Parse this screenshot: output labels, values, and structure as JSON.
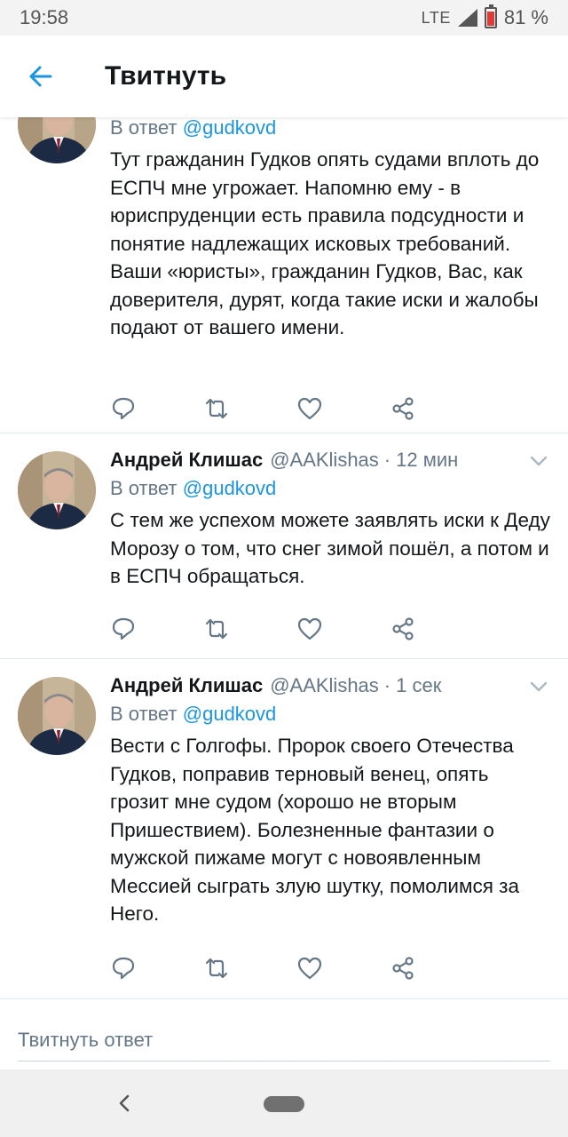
{
  "status_bar": {
    "time": "19:58",
    "network": "LTE",
    "battery_text": "81 %",
    "battery_level": 0.81
  },
  "app_bar": {
    "back_icon": "arrow-left-icon",
    "title": "Твитнуть"
  },
  "tweets": [
    {
      "name": "",
      "handle": "",
      "time": "",
      "reply_prefix": "В ответ",
      "reply_to": "@gudkovd",
      "text": "Тут гражданин Гудков опять судами вплоть до ЕСПЧ мне угрожает. Напомню ему - в юриспруденции есть правила подсудности и понятие надлежащих исковых требований. Ваши «юристы», гражданин Гудков, Вас, как доверителя, дурят, когда такие иски и жалобы подают от вашего имени."
    },
    {
      "name": "Андрей Клишас",
      "handle": "@AAKlishas",
      "dot": "·",
      "time": "12 мин",
      "reply_prefix": "В ответ",
      "reply_to": "@gudkovd",
      "text": "С тем же успехом можете заявлять иски к Деду Морозу о том, что снег зимой пошёл, а потом и в ЕСПЧ обращаться."
    },
    {
      "name": "Андрей Клишас",
      "handle": "@AAKlishas",
      "dot": "·",
      "time": "1 сек",
      "reply_prefix": "В ответ",
      "reply_to": "@gudkovd",
      "text": "Вести с Голгофы. Пророк своего Отечества Гудков, поправив терновый венец, опять грозит мне судом (хорошо не вторым Пришествием). Болезненные фантазии о мужской пижаме могут с новоявленным Мессией сыграть злую шутку, помолимся за Него."
    }
  ],
  "tweet_actions": [
    "reply-icon",
    "retweet-icon",
    "like-icon",
    "share-icon"
  ],
  "compose": {
    "placeholder": "Твитнуть ответ"
  },
  "nav_bar": {
    "back_icon": "chevron-left-icon",
    "home_icon": "home-pill-icon"
  },
  "colors": {
    "accent": "#1b95e0",
    "muted": "#657786",
    "text": "#14171a",
    "divider": "#e1e8ed",
    "battery_fill": "#e53935"
  }
}
